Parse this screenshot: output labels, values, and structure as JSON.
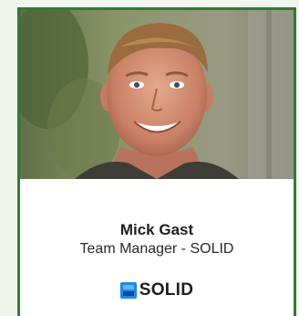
{
  "person": {
    "name": "Mick Gast",
    "title": "Team Manager - SOLID"
  },
  "company_logo": {
    "text": "SOLID",
    "icon": "solid-logo-icon"
  },
  "colors": {
    "card_border": "#2e7d32",
    "page_background": "#f2f5ee",
    "logo_blue": "#1e88e5"
  }
}
